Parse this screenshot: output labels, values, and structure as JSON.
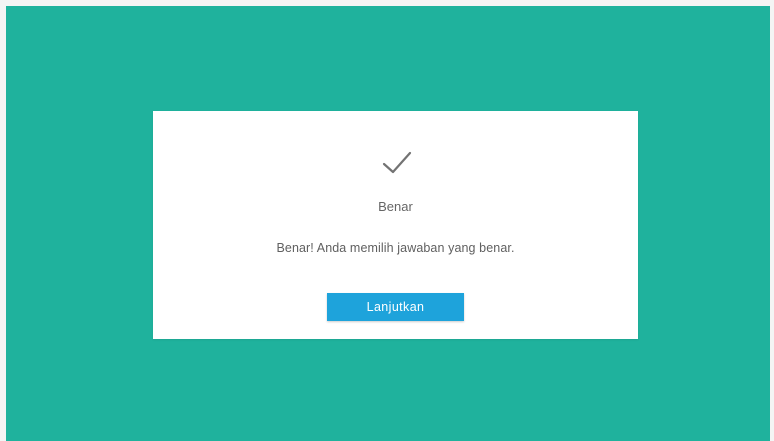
{
  "dialog": {
    "icon": "checkmark-icon",
    "title": "Benar",
    "message": "Benar!  Anda memilih jawaban yang benar.",
    "continue_label": "Lanjutkan"
  },
  "colors": {
    "background": "#1fb29d",
    "dialog": "#ffffff",
    "button": "#1ea3db",
    "checkmark": "#737373"
  }
}
